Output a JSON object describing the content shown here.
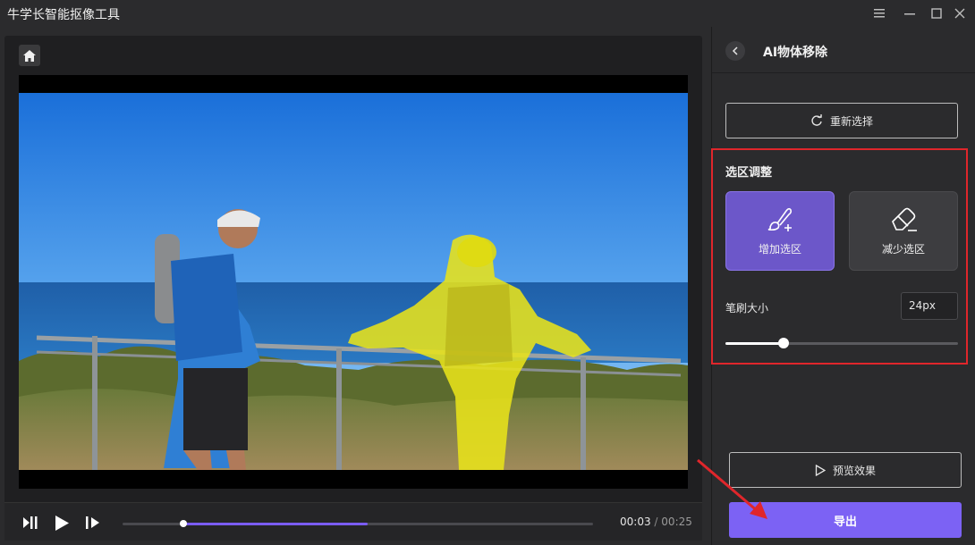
{
  "app": {
    "title": "牛学长智能抠像工具"
  },
  "window_controls": [
    "menu-icon",
    "minimize-icon",
    "maximize-icon",
    "close-icon"
  ],
  "player": {
    "current_time": "00:03",
    "separator": "/",
    "total_time": "00:25",
    "progress_fraction": 0.52,
    "playhead_fraction": 0.13
  },
  "panel": {
    "title": "AI物体移除",
    "reselect_label": "重新选择",
    "section_title": "选区调整",
    "add_label": "增加选区",
    "reduce_label": "减少选区",
    "brush_label": "笔刷大小",
    "brush_value": "24px",
    "brush_fraction": 0.25,
    "preview_label": "预览效果",
    "export_label": "导出"
  },
  "colors": {
    "accent": "#7c62f4",
    "active_tool": "#6c57c9",
    "highlight": "#e0262b",
    "mask": "#e8e21a"
  }
}
